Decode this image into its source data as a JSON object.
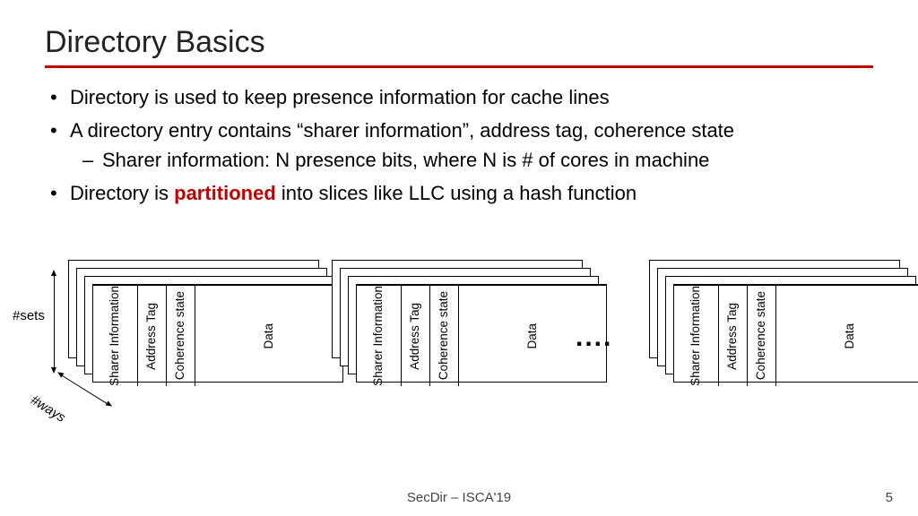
{
  "title": "Directory Basics",
  "bullets": {
    "b1": "Directory is used to keep presence information for cache lines",
    "b2": "A directory entry contains “sharer information”, address tag, coherence state",
    "b2a": "Sharer information: N presence bits, where N is # of cores in machine",
    "b3_pre": "Directory is ",
    "b3_emph": "partitioned",
    "b3_post": " into slices like LLC using a hash function"
  },
  "labels": {
    "sets": "#sets",
    "ways": "#ways",
    "dots": "....",
    "sharer": "Sharer\nInformation",
    "tag": "Address Tag",
    "coh": "Coherence state",
    "data": "Data"
  },
  "footer": "SecDir – ISCA'19",
  "page": "5"
}
